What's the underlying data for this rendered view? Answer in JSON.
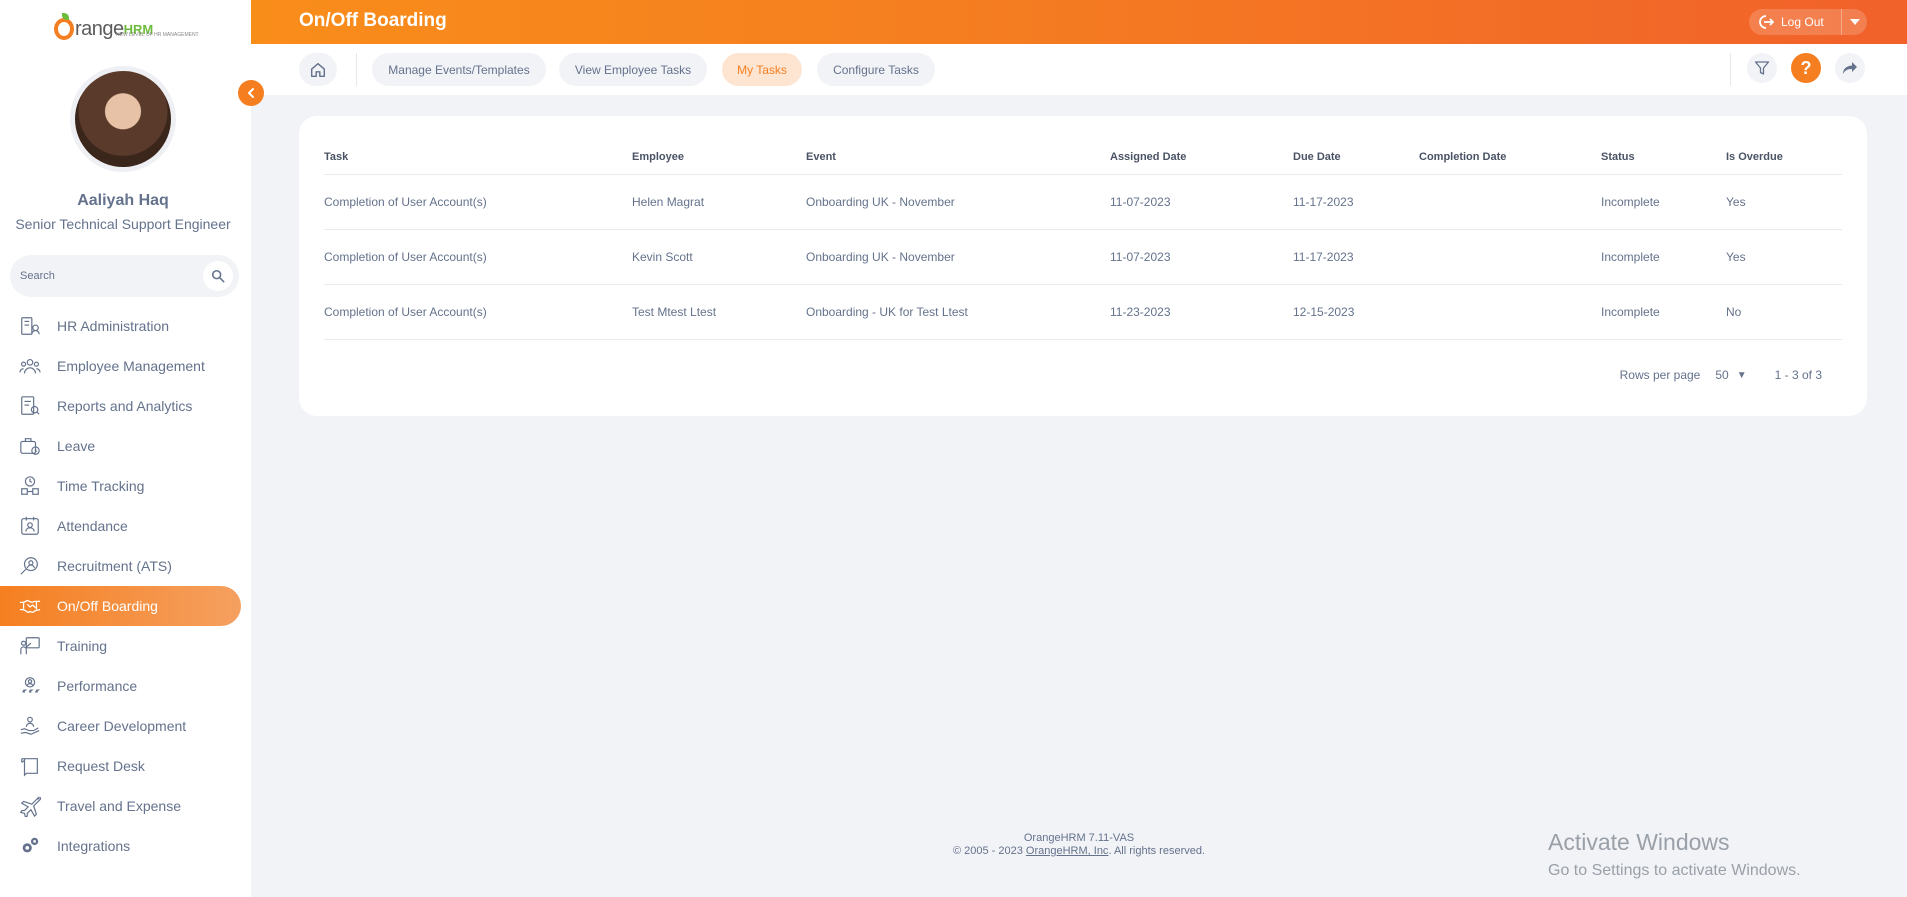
{
  "app": {
    "logo_text_main": "range",
    "logo_text_hrm": "HRM",
    "logo_tagline": "NEW LEVEL OF HR MANAGEMENT",
    "accent_color": "#f57f20"
  },
  "user": {
    "name": "Aaliyah Haq",
    "title": "Senior Technical Support Engineer"
  },
  "search": {
    "placeholder": "Search",
    "value": ""
  },
  "sidebar": {
    "items": [
      {
        "label": "HR Administration",
        "icon": "hr-admin-icon"
      },
      {
        "label": "Employee Management",
        "icon": "employee-management-icon"
      },
      {
        "label": "Reports and Analytics",
        "icon": "reports-icon"
      },
      {
        "label": "Leave",
        "icon": "leave-icon"
      },
      {
        "label": "Time Tracking",
        "icon": "time-tracking-icon"
      },
      {
        "label": "Attendance",
        "icon": "attendance-icon"
      },
      {
        "label": "Recruitment (ATS)",
        "icon": "recruitment-icon"
      },
      {
        "label": "On/Off Boarding",
        "icon": "handshake-icon",
        "active": true
      },
      {
        "label": "Training",
        "icon": "training-icon"
      },
      {
        "label": "Performance",
        "icon": "performance-icon"
      },
      {
        "label": "Career Development",
        "icon": "career-development-icon"
      },
      {
        "label": "Request Desk",
        "icon": "request-desk-icon"
      },
      {
        "label": "Travel and Expense",
        "icon": "airplane-icon"
      },
      {
        "label": "Integrations",
        "icon": "gears-icon"
      }
    ]
  },
  "header": {
    "title": "On/Off Boarding",
    "logout_label": "Log Out"
  },
  "tabs": [
    {
      "label": "Manage Events/Templates"
    },
    {
      "label": "View Employee Tasks"
    },
    {
      "label": "My Tasks",
      "active": true
    },
    {
      "label": "Configure Tasks"
    }
  ],
  "table": {
    "columns": [
      "Task",
      "Employee",
      "Event",
      "Assigned Date",
      "Due Date",
      "Completion Date",
      "Status",
      "Is Overdue"
    ],
    "rows": [
      [
        "Completion of User Account(s)",
        "Helen Magrat",
        "Onboarding UK - November",
        "11-07-2023",
        "11-17-2023",
        "",
        "Incomplete",
        "Yes"
      ],
      [
        "Completion of User Account(s)",
        "Kevin Scott",
        "Onboarding UK - November",
        "11-07-2023",
        "11-17-2023",
        "",
        "Incomplete",
        "Yes"
      ],
      [
        "Completion of User Account(s)",
        "Test Mtest Ltest",
        "Onboarding - UK for Test Ltest",
        "11-23-2023",
        "12-15-2023",
        "",
        "Incomplete",
        "No"
      ]
    ]
  },
  "pager": {
    "rows_per_page_label": "Rows per page",
    "rows_per_page_value": "50",
    "range_text": "1 - 3 of 3"
  },
  "footer": {
    "version": "OrangeHRM 7.11-VAS",
    "copyright_prefix": "© 2005 - 2023 ",
    "company_link": "OrangeHRM, Inc",
    "copyright_suffix": ". All rights reserved."
  },
  "watermark": {
    "line1": "Activate Windows",
    "line2": "Go to Settings to activate Windows."
  }
}
